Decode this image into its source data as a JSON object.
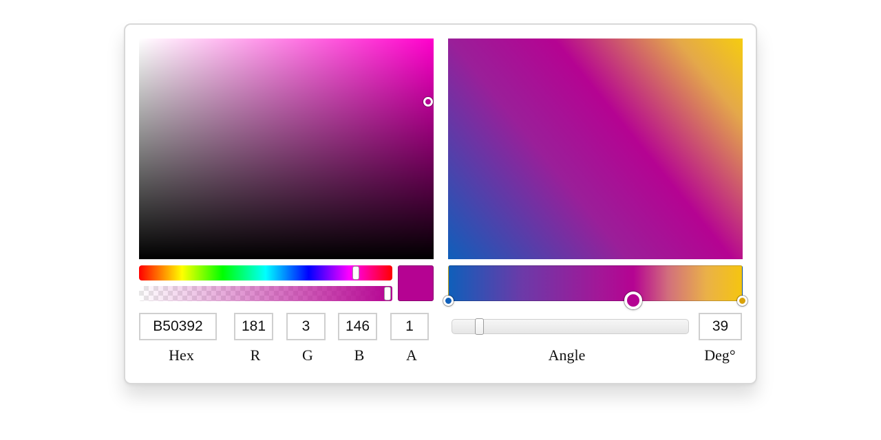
{
  "color": {
    "hex": "B50392",
    "r": "181",
    "g": "3",
    "b": "146",
    "a": "1",
    "labels": {
      "hex": "Hex",
      "r": "R",
      "g": "G",
      "b": "B",
      "a": "A"
    },
    "hue_level": 0.86,
    "alpha_level": 1.0
  },
  "gradient": {
    "angle_value": "39",
    "angle_label": "Angle",
    "deg_label": "Deg°",
    "stops": [
      {
        "color": "#0f5fba",
        "position": 0
      },
      {
        "color": "#b50392",
        "position": 63
      },
      {
        "color": "#f5c510",
        "position": 100
      }
    ],
    "selected_stop_color": "#b50392"
  },
  "colors": {
    "selected": "#b50392",
    "panel_border": "#d8d8d8"
  }
}
